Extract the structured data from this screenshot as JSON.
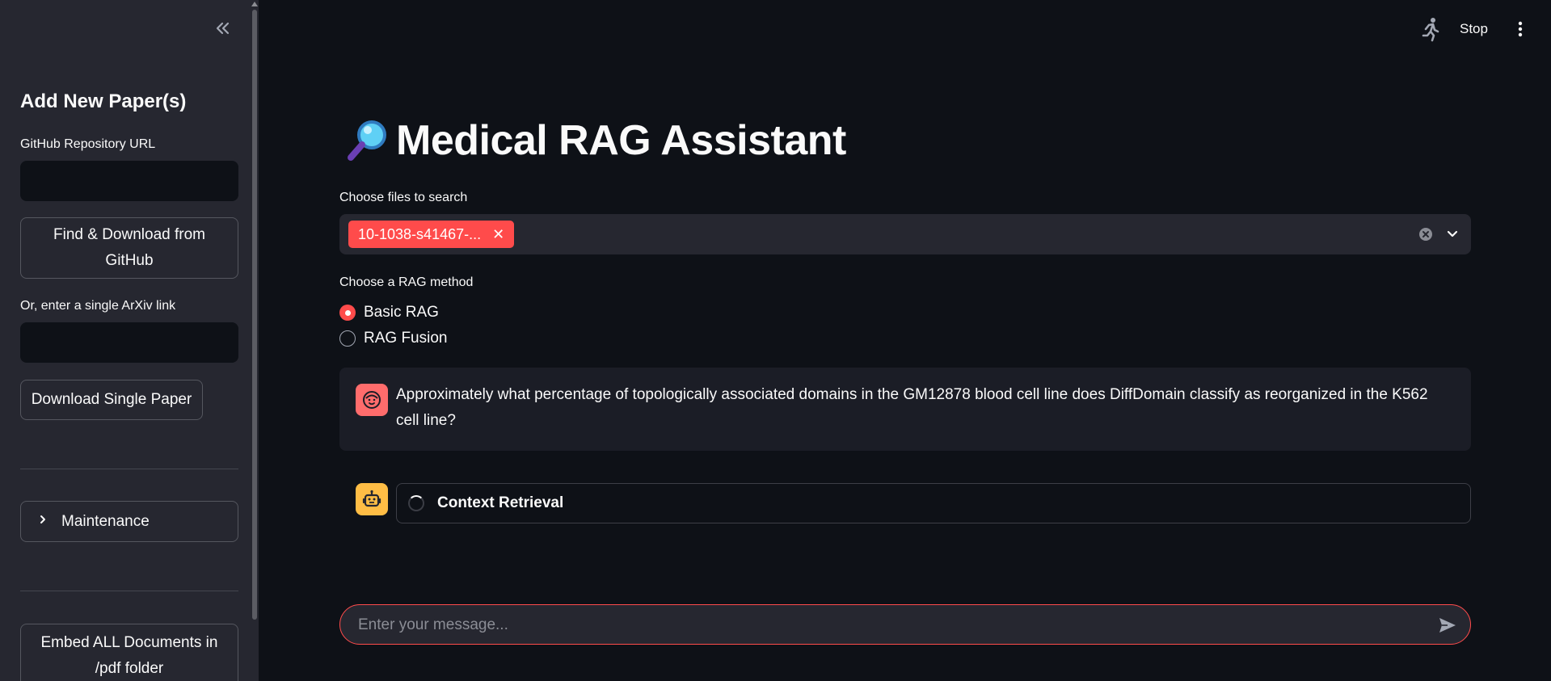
{
  "sidebar": {
    "title": "Add New Paper(s)",
    "github_label": "GitHub Repository URL",
    "github_value": "",
    "github_button": "Find & Download from GitHub",
    "arxiv_label": "Or, enter a single ArXiv link",
    "arxiv_value": "",
    "arxiv_button": "Download Single Paper",
    "maintenance_label": "Maintenance",
    "embed_button": "Embed ALL Documents in /pdf folder"
  },
  "topbar": {
    "stop_label": "Stop"
  },
  "main": {
    "title": "Medical RAG Assistant",
    "files_label": "Choose files to search",
    "selected_files": [
      "10-1038-s41467-..."
    ],
    "rag_label": "Choose a RAG method",
    "rag_options": [
      {
        "label": "Basic RAG",
        "selected": true
      },
      {
        "label": "RAG Fusion",
        "selected": false
      }
    ],
    "user_message": "Approximately what percentage of topologically associated domains in the GM12878 blood cell line does DiffDomain classify as reorganized in the K562 cell line?",
    "status_label": "Context Retrieval",
    "chat_placeholder": "Enter your message...",
    "chat_value": ""
  },
  "colors": {
    "accent": "#ff4b4b",
    "background": "#0e1117",
    "sidebar_bg": "#262730",
    "bot_avatar": "#ffbd45",
    "user_avatar": "#ff6c6c"
  },
  "icons": {
    "collapse": "double-chevron-left-icon",
    "running": "running-man-icon",
    "menu": "vertical-dots-icon",
    "title": "magnifying-glass-icon",
    "user_avatar": "face-icon",
    "bot_avatar": "robot-icon",
    "send": "send-icon"
  }
}
